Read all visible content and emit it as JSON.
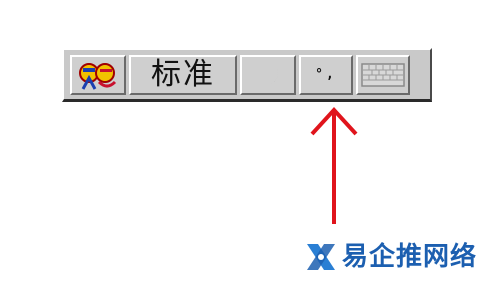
{
  "ime_toolbar": {
    "buttons": [
      {
        "id": "ime-logo",
        "icon": "ime-logo-icon"
      },
      {
        "id": "input-mode",
        "label": "标准"
      },
      {
        "id": "full-half-width",
        "icon": "moon-icon"
      },
      {
        "id": "punctuation",
        "label": "°,"
      },
      {
        "id": "soft-keyboard",
        "icon": "keyboard-icon"
      }
    ]
  },
  "annotation": {
    "arrow_color": "#e0141c"
  },
  "watermark": {
    "text": "易企推网络",
    "logo": "x-logo-icon",
    "color": "#1c5fb0"
  }
}
